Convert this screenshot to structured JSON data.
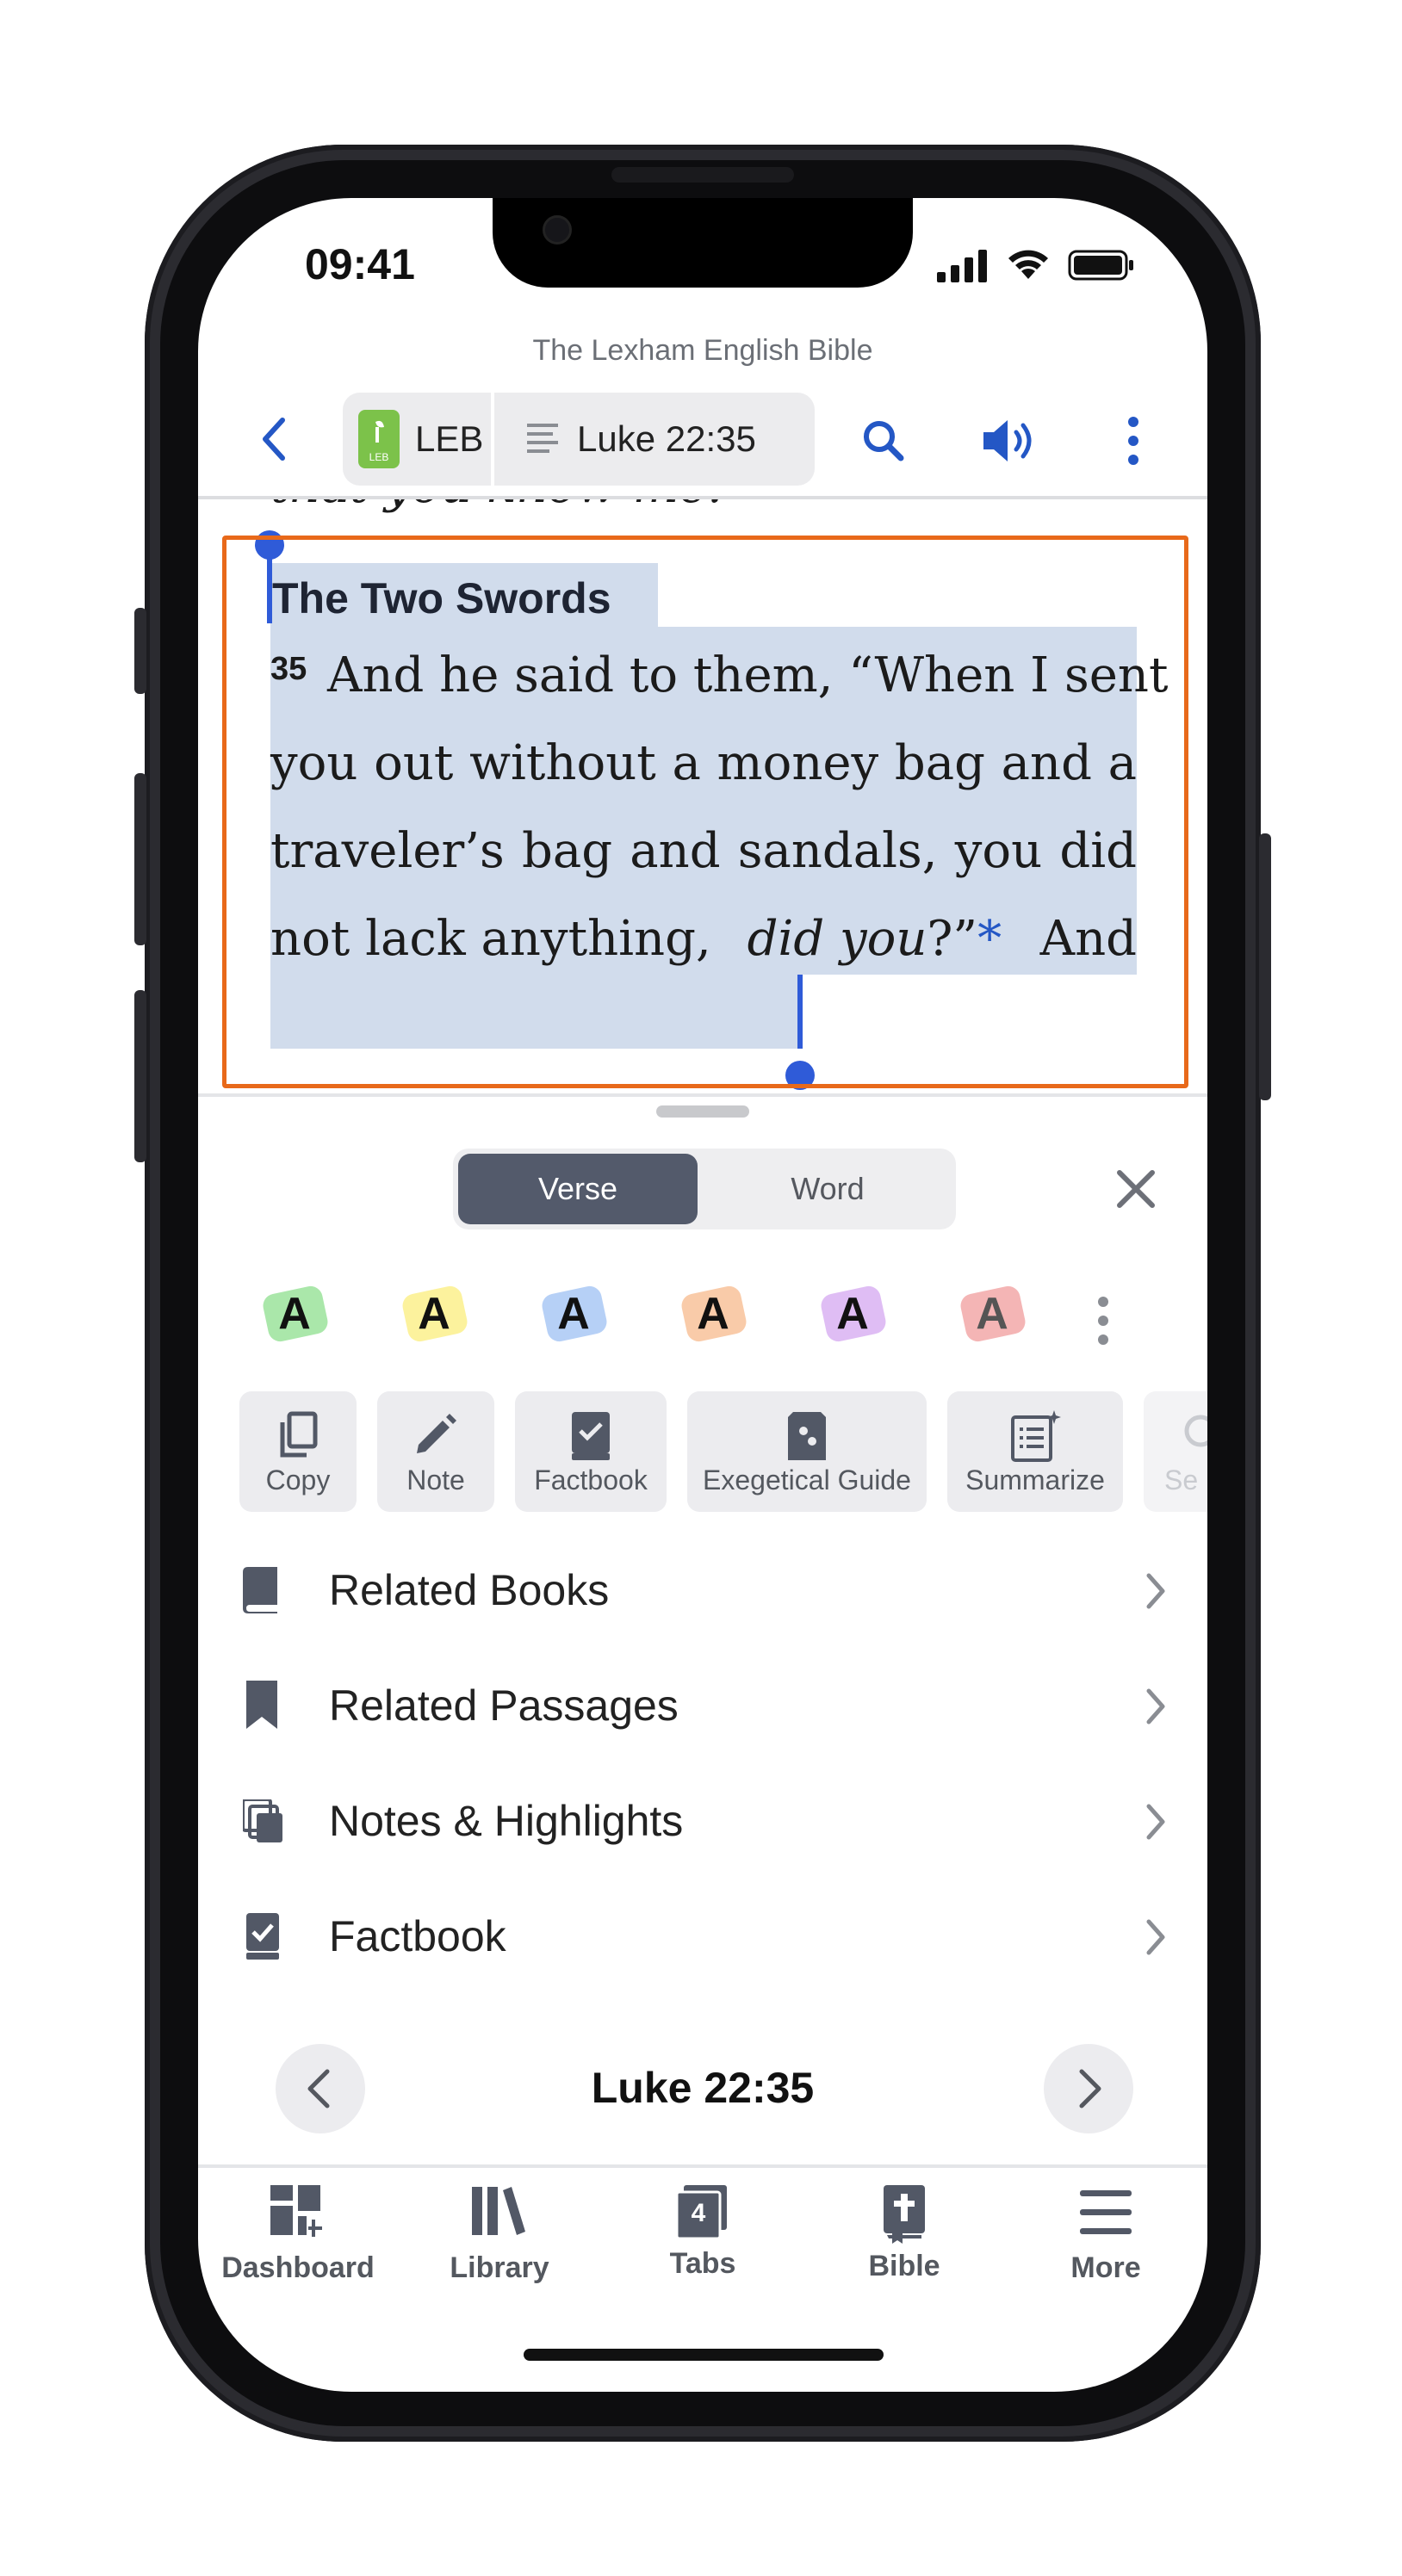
{
  "status": {
    "time": "09:41"
  },
  "app": {
    "title": "The Lexham English Bible"
  },
  "toolbar": {
    "version": "LEB",
    "version_badge_text": "LEB",
    "reference": "Luke 22:35"
  },
  "reader": {
    "prev_line": "that you know me.”",
    "heading": "The Two Swords",
    "verse_number": "35",
    "lines": [
      "And he said to them, “When I sent",
      "you out without a money bag and a",
      "traveler’s bag and sandals, you did"
    ],
    "last_line_start": "not lack anything,",
    "last_line_italic": "did you",
    "last_line_mid": "?”",
    "footnote_marker": "*",
    "last_line_end": "And"
  },
  "panel": {
    "segments": {
      "verse": "Verse",
      "word": "Word"
    },
    "highlight_letter": "A",
    "highlight_colors": [
      "#9be39b",
      "#fbf08c",
      "#a9c8f5",
      "#f8c29a",
      "#d9b1f2",
      "#f2a8a8"
    ],
    "actions": [
      {
        "label": "Copy",
        "icon": "copy-icon"
      },
      {
        "label": "Note",
        "icon": "pencil-icon"
      },
      {
        "label": "Factbook",
        "icon": "factbook-icon"
      },
      {
        "label": "Exegetical Guide",
        "icon": "exegetical-guide-icon"
      },
      {
        "label": "Summarize",
        "icon": "summarize-icon"
      },
      {
        "label": "Se",
        "icon": "search-icon"
      }
    ],
    "list": [
      {
        "label": "Related Books",
        "icon": "book-icon"
      },
      {
        "label": "Related Passages",
        "icon": "bookmark-icon"
      },
      {
        "label": "Notes & Highlights",
        "icon": "notes-icon"
      },
      {
        "label": "Factbook",
        "icon": "factbook-icon"
      }
    ],
    "current_reference": "Luke 22:35"
  },
  "tabbar": {
    "items": [
      {
        "label": "Dashboard",
        "icon": "dashboard-icon"
      },
      {
        "label": "Library",
        "icon": "library-icon"
      },
      {
        "label": "Tabs",
        "icon": "tabs-icon",
        "badge": "4"
      },
      {
        "label": "Bible",
        "icon": "bible-icon"
      },
      {
        "label": "More",
        "icon": "menu-icon"
      }
    ]
  },
  "colors": {
    "accent_blue": "#2457c5",
    "selection": "#d1dcec",
    "annotation_box": "#e8691a",
    "segment_active": "#535a6b"
  }
}
